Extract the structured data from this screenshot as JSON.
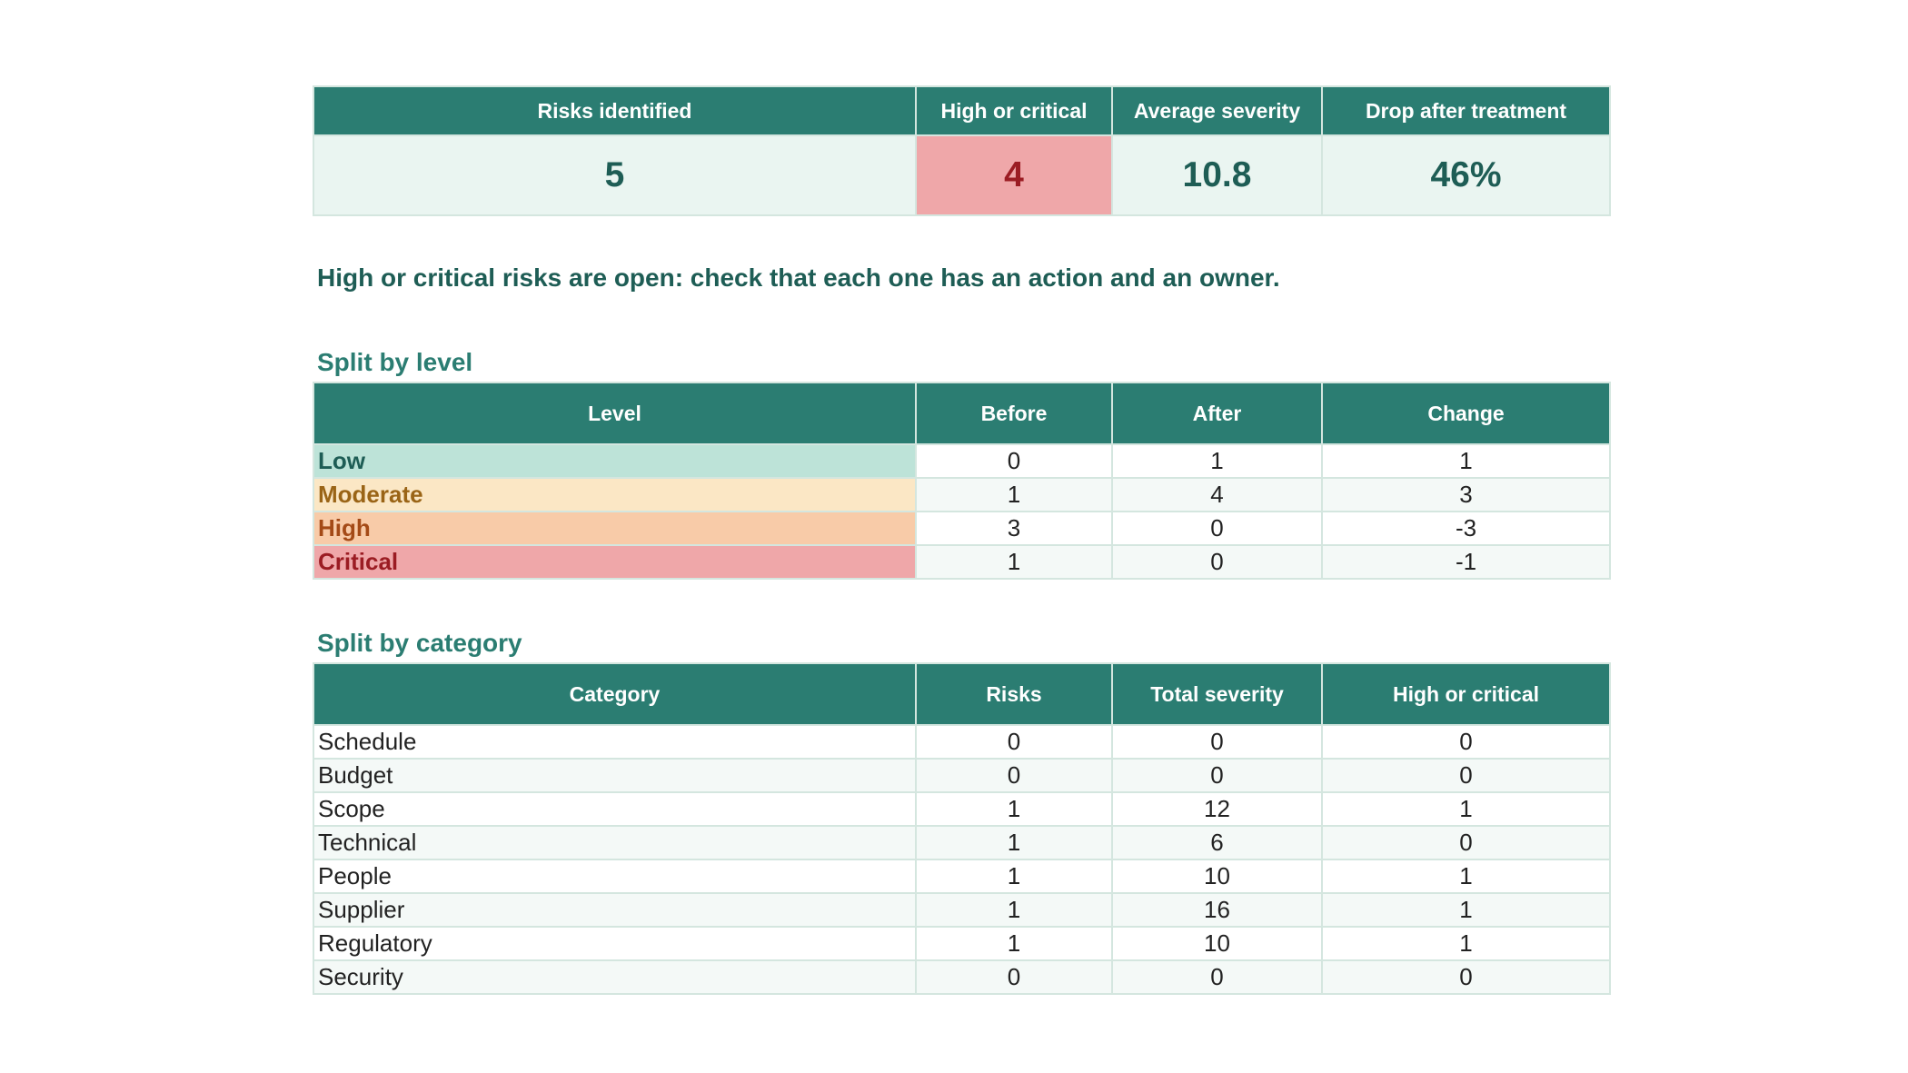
{
  "kpi": {
    "headers": [
      "Risks identified",
      "High or critical",
      "Average severity",
      "Drop after treatment"
    ],
    "values": [
      "5",
      "4",
      "10.8",
      "46%"
    ]
  },
  "message": "High or critical risks are open: check that each one has an action and an owner.",
  "level_split": {
    "title": "Split by level",
    "headers": [
      "Level",
      "Before",
      "After",
      "Change"
    ],
    "rows": [
      {
        "level": "Low",
        "before": "0",
        "after": "1",
        "change": "1",
        "color": "#bde3d8"
      },
      {
        "level": "Moderate",
        "before": "1",
        "after": "4",
        "change": "3",
        "color": "#fbe7c5"
      },
      {
        "level": "High",
        "before": "3",
        "after": "0",
        "change": "-3",
        "color": "#f8cba8"
      },
      {
        "level": "Critical",
        "before": "1",
        "after": "0",
        "change": "-1",
        "color": "#efa7a9"
      }
    ]
  },
  "category_split": {
    "title": "Split by category",
    "headers": [
      "Category",
      "Risks",
      "Total severity",
      "High or critical"
    ],
    "rows": [
      {
        "category": "Schedule",
        "risks": "0",
        "total_severity": "0",
        "high_or_critical": "0"
      },
      {
        "category": "Budget",
        "risks": "0",
        "total_severity": "0",
        "high_or_critical": "0"
      },
      {
        "category": "Scope",
        "risks": "1",
        "total_severity": "12",
        "high_or_critical": "1"
      },
      {
        "category": "Technical",
        "risks": "1",
        "total_severity": "6",
        "high_or_critical": "0"
      },
      {
        "category": "People",
        "risks": "1",
        "total_severity": "10",
        "high_or_critical": "1"
      },
      {
        "category": "Supplier",
        "risks": "1",
        "total_severity": "16",
        "high_or_critical": "1"
      },
      {
        "category": "Regulatory",
        "risks": "1",
        "total_severity": "10",
        "high_or_critical": "1"
      },
      {
        "category": "Security",
        "risks": "0",
        "total_severity": "0",
        "high_or_critical": "0"
      }
    ]
  },
  "colors": {
    "header": "#2b7d72",
    "kpi_alert": "#efa7a9",
    "title_text": "#1e5d55"
  }
}
